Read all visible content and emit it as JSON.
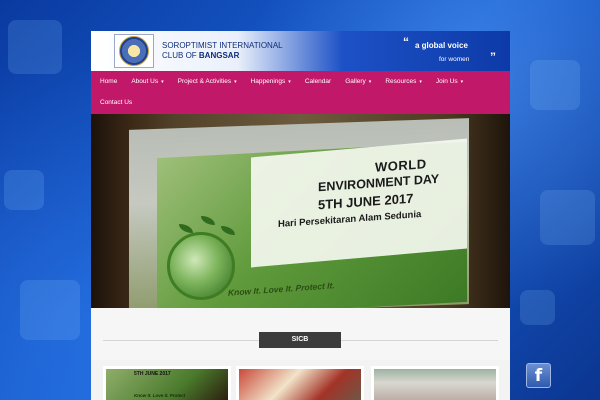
{
  "header": {
    "org_line1": "SOROPTIMIST INTERNATIONAL",
    "org_line2_prefix": "CLUB OF ",
    "org_line2_bold": "BANGSAR",
    "tagline_open_quote": "“",
    "tagline_line1": "a global voice",
    "tagline_line2": "for women",
    "tagline_close_quote": "”"
  },
  "nav": {
    "items": [
      {
        "label": "Home",
        "has_dropdown": false
      },
      {
        "label": "About Us",
        "has_dropdown": true
      },
      {
        "label": "Project & Activities",
        "has_dropdown": true
      },
      {
        "label": "Happenings",
        "has_dropdown": true
      },
      {
        "label": "Calendar",
        "has_dropdown": false
      },
      {
        "label": "Gallery",
        "has_dropdown": true
      },
      {
        "label": "Resources",
        "has_dropdown": true
      },
      {
        "label": "Join Us",
        "has_dropdown": true
      },
      {
        "label": "Contact Us",
        "has_dropdown": false
      }
    ],
    "chevron": "▾"
  },
  "slider": {
    "title_line1": "WORLD",
    "title_line2": "ENVIRONMENT DAY",
    "title_line3": "5TH JUNE 2017",
    "title_line4": "Hari Persekitaran Alam Sedunia",
    "slogan": "Know It. Love It. Protect It."
  },
  "section": {
    "label": "SICB"
  },
  "thumbnails": {
    "thumb1_text1": "5TH JUNE 2017",
    "thumb1_text2": "Know It. Love It. Protect"
  },
  "social": {
    "facebook_glyph": "f"
  },
  "colors": {
    "nav_bg": "#c2186a",
    "header_blue": "#0d3aa8",
    "section_label_bg": "#3c3c3c"
  }
}
